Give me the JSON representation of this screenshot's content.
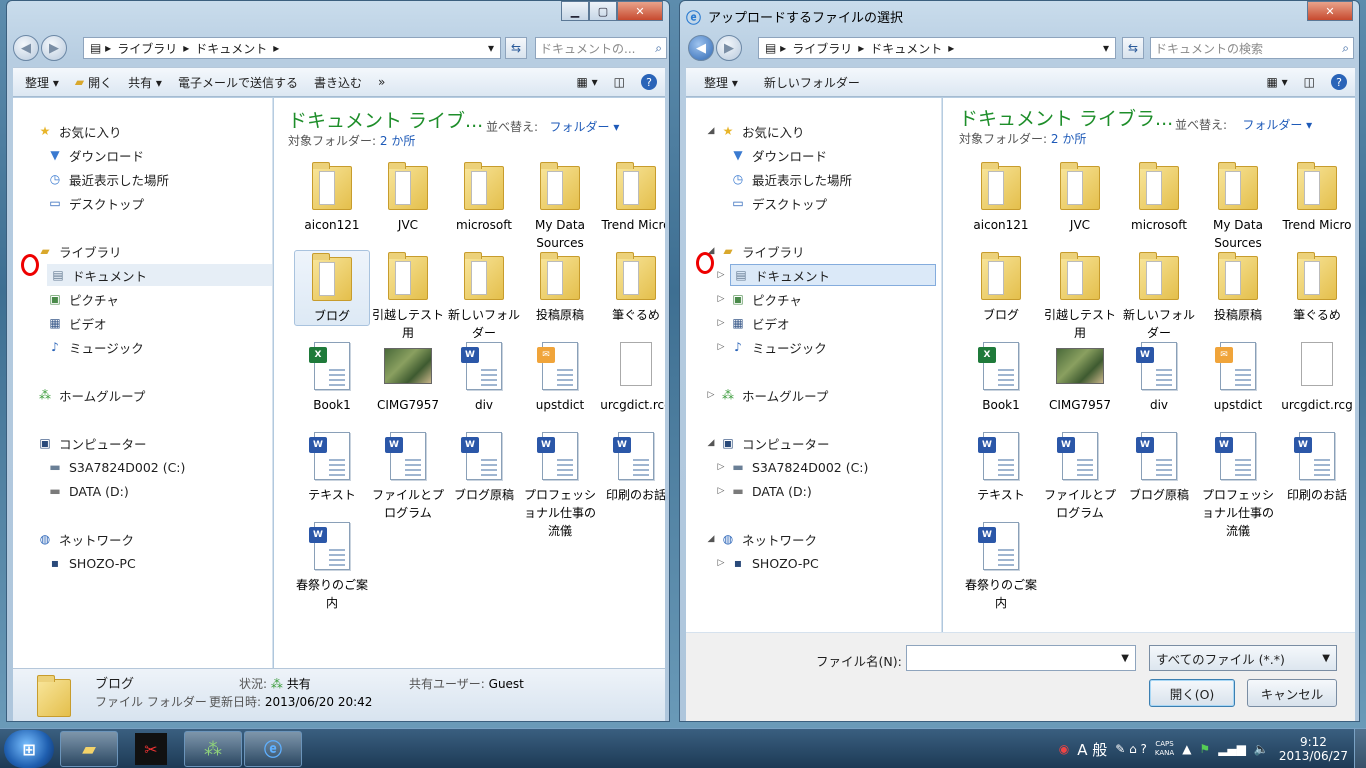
{
  "left": {
    "title": "",
    "address": [
      "ライブラリ",
      "ドキュメント"
    ],
    "search_placeholder": "ドキュメントの...",
    "commands": [
      "整理 ▾",
      "開く",
      "共有 ▾",
      "電子メールで送信する",
      "書き込む",
      "»"
    ],
    "nav": [
      {
        "label": "お気に入り",
        "icon": "star-icon"
      },
      {
        "label": "ダウンロード",
        "icon": "download-folder-icon"
      },
      {
        "label": "最近表示した場所",
        "icon": "recent-places-icon"
      },
      {
        "label": "デスクトップ",
        "icon": "desktop-icon"
      },
      {
        "label": "ライブラリ",
        "icon": "library-icon"
      },
      {
        "label": "ドキュメント",
        "icon": "documents-icon"
      },
      {
        "label": "ピクチャ",
        "icon": "pictures-icon"
      },
      {
        "label": "ビデオ",
        "icon": "videos-icon"
      },
      {
        "label": "ミュージック",
        "icon": "music-icon"
      },
      {
        "label": "ホームグループ",
        "icon": "homegroup-icon"
      },
      {
        "label": "コンピューター",
        "icon": "computer-icon"
      },
      {
        "label": "S3A7824D002 (C:)",
        "icon": "drive-c-icon"
      },
      {
        "label": "DATA (D:)",
        "icon": "drive-d-icon"
      },
      {
        "label": "ネットワーク",
        "icon": "network-icon"
      },
      {
        "label": "SHOZO-PC",
        "icon": "pc-icon"
      }
    ],
    "lib_title": "ドキュメント ライブ...",
    "lib_sub_label": "対象フォルダー:",
    "lib_sub_link": "2 か所",
    "sort_label": "並べ替え:",
    "sort_value": "フォルダー ▾",
    "details": {
      "name": "ブログ",
      "type": "ファイル フォルダー",
      "state_label": "状況:",
      "state_value": "共有",
      "modified_label": "更新日時:",
      "modified_value": "2013/06/20 20:42",
      "shared_label": "共有ユーザー:",
      "shared_value": "Guest"
    }
  },
  "right": {
    "title": "アップロードするファイルの選択",
    "address": [
      "ライブラリ",
      "ドキュメント"
    ],
    "search_placeholder": "ドキュメントの検索",
    "commands": [
      "整理 ▾",
      "新しいフォルダー"
    ],
    "lib_title": "ドキュメント ライブラ...",
    "lib_sub_label": "対象フォルダー:",
    "lib_sub_link": "2 か所",
    "sort_label": "並べ替え:",
    "sort_value": "フォルダー ▾",
    "filename_label": "ファイル名(N):",
    "filename_value": "",
    "filter_value": "すべてのファイル (*.*)",
    "open_label": "開く(O)",
    "cancel_label": "キャンセル"
  },
  "files": [
    {
      "name": "aicon121",
      "kind": "folder"
    },
    {
      "name": "JVC",
      "kind": "folder"
    },
    {
      "name": "microsoft",
      "kind": "folder"
    },
    {
      "name": "My Data Sources",
      "kind": "folder"
    },
    {
      "name": "Trend Micro",
      "kind": "folder"
    },
    {
      "name": "ブログ",
      "kind": "folder"
    },
    {
      "name": "引越しテスト用",
      "kind": "folder"
    },
    {
      "name": "新しいフォルダー",
      "kind": "folder"
    },
    {
      "name": "投稿原稿",
      "kind": "folder"
    },
    {
      "name": "筆ぐるめ",
      "kind": "folder"
    },
    {
      "name": "Book1",
      "kind": "excel"
    },
    {
      "name": "CIMG7957",
      "kind": "photo"
    },
    {
      "name": "div",
      "kind": "word"
    },
    {
      "name": "upstdict",
      "kind": "mail"
    },
    {
      "name": "urcgdict.rcg",
      "kind": "blank"
    },
    {
      "name": "テキスト",
      "kind": "word"
    },
    {
      "name": "ファイルとプログラム",
      "kind": "word"
    },
    {
      "name": "ブログ原稿",
      "kind": "word"
    },
    {
      "name": "プロフェッショナル仕事の流儀",
      "kind": "word"
    },
    {
      "name": "印刷のお話",
      "kind": "word"
    },
    {
      "name": "春祭りのご案内",
      "kind": "word"
    }
  ],
  "taskbar": {
    "ime": "A 般",
    "caps": "CAPS",
    "kana": "KANA",
    "time": "9:12",
    "date": "2013/06/27"
  }
}
